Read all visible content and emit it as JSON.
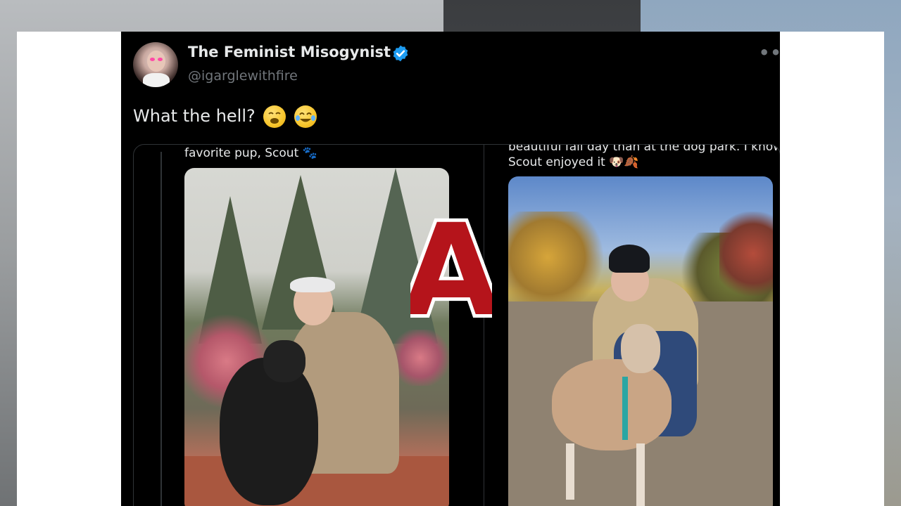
{
  "tweet": {
    "display_name": "The Feminist Misogynist",
    "handle": "@igarglewithfire",
    "text": "What the hell?",
    "emojis": [
      "weary-face",
      "tears-of-joy-face"
    ],
    "more_label": "•••"
  },
  "quotes": {
    "left_caption": "favorite pup, Scout 🐾",
    "right_caption_line1": "beautiful fall day than at the dog park. I know",
    "right_caption_line2": "Scout enjoyed it 🐶🍂"
  },
  "overlay": {
    "letter": "A",
    "fill_color": "#b5141b",
    "stroke_color": "#ffffff"
  },
  "colors": {
    "verified": "#1d9bf0",
    "text": "#e7e9ea",
    "muted": "#71767b"
  }
}
